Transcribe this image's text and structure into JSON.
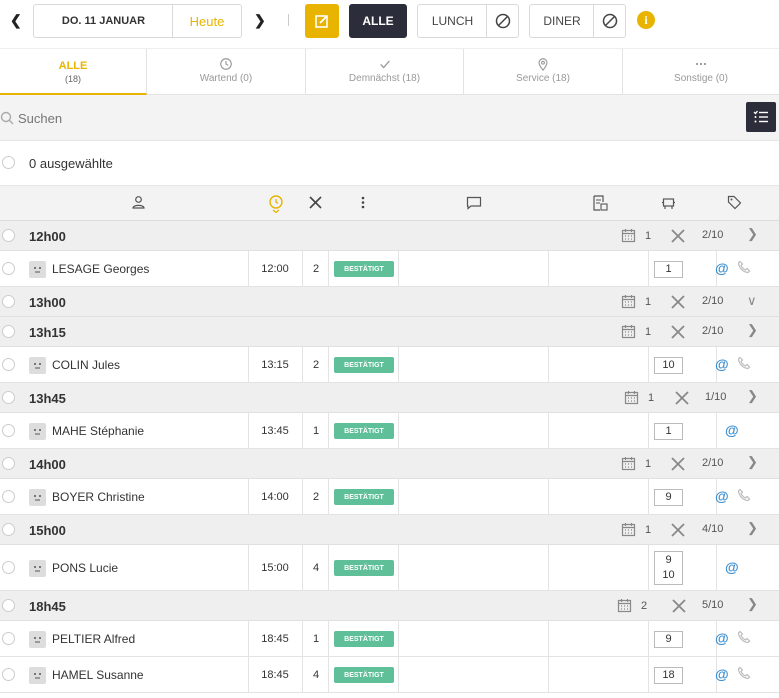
{
  "header": {
    "date_label": "DO. 11 JANUAR",
    "today_label": "Heute",
    "all_label": "ALLE",
    "lunch_label": "LUNCH",
    "diner_label": "DINER"
  },
  "tabs": [
    {
      "label": "ALLE",
      "count": "(18)"
    },
    {
      "label": "Wartend (0)"
    },
    {
      "label": "Demnächst (18)"
    },
    {
      "label": "Service (18)"
    },
    {
      "label": "Sonstige (0)"
    }
  ],
  "search": {
    "placeholder": "Suchen"
  },
  "selection": {
    "label": "0 ausgewählte"
  },
  "status_label": "BESTÄTIGT",
  "groups": [
    {
      "time": "12h00",
      "res": "1",
      "covers": "2/10"
    },
    {
      "time": "13h00",
      "res": "1",
      "covers": "2/10"
    },
    {
      "time": "13h15",
      "res": "1",
      "covers": "2/10"
    },
    {
      "time": "13h45",
      "res": "1",
      "covers": "1/10"
    },
    {
      "time": "14h00",
      "res": "1",
      "covers": "2/10"
    },
    {
      "time": "15h00",
      "res": "1",
      "covers": "4/10"
    },
    {
      "time": "18h45",
      "res": "2",
      "covers": "5/10"
    }
  ],
  "rows": [
    {
      "name": "LESAGE Georges",
      "time": "12:00",
      "pax": "2",
      "table": "1"
    },
    {
      "name": "COLIN Jules",
      "time": "13:15",
      "pax": "2",
      "table": "10"
    },
    {
      "name": "MAHE Stéphanie",
      "time": "13:45",
      "pax": "1",
      "table": "1"
    },
    {
      "name": "BOYER Christine",
      "time": "14:00",
      "pax": "2",
      "table": "9"
    },
    {
      "name": "PONS Lucie",
      "time": "15:00",
      "pax": "4",
      "table": "9",
      "table2": "10"
    },
    {
      "name": "PELTIER Alfred",
      "time": "18:45",
      "pax": "1",
      "table": "9"
    },
    {
      "name": "HAMEL Susanne",
      "time": "18:45",
      "pax": "4",
      "table": "18"
    }
  ],
  "colors": {
    "accent": "#e8b400",
    "dark": "#2b2d3a",
    "confirmed": "#5fbf98",
    "link": "#3d8fd0"
  }
}
